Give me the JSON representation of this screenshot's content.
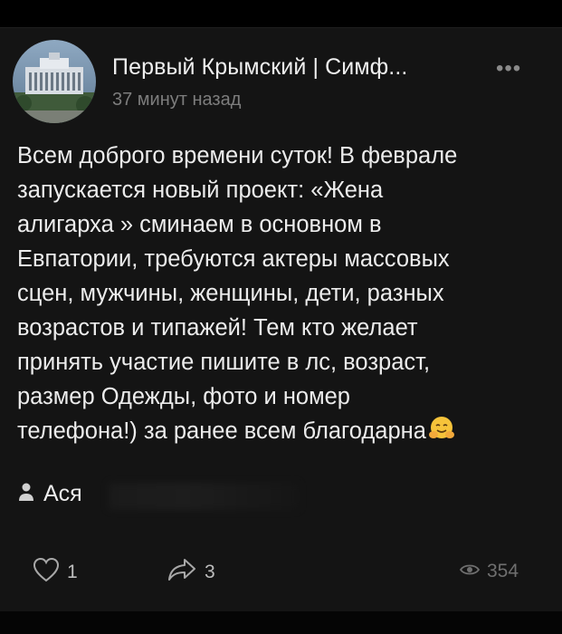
{
  "post": {
    "author": "Первый Крымский | Симф...",
    "more_label": "•••",
    "timestamp": "37 минут назад",
    "body": "Всем доброго времени суток! В феврале\nзапускается новый проект: «Жена\nалигарха » сминаем в основном в\nЕвпатории, требуются актеры массовых\nсцен, мужчины, женщины, дети, разных\nвозрастов и типажей! Тем кто желает\nпринять участие пишите в лс, возраст,\nразмер Одежды, фото и номер\nтелефона!) за ранее всем благодарна",
    "body_end_emoji": "hugging-face-icon",
    "signature_name": "Ася"
  },
  "actions": {
    "likes": "1",
    "shares": "3",
    "views": "354"
  },
  "icons": {
    "like": "heart-icon",
    "share": "share-arrow-icon",
    "views": "eye-icon",
    "signature": "user-icon"
  },
  "colors": {
    "background": "#141414",
    "text": "#ececec",
    "muted": "#7d7d7d"
  }
}
